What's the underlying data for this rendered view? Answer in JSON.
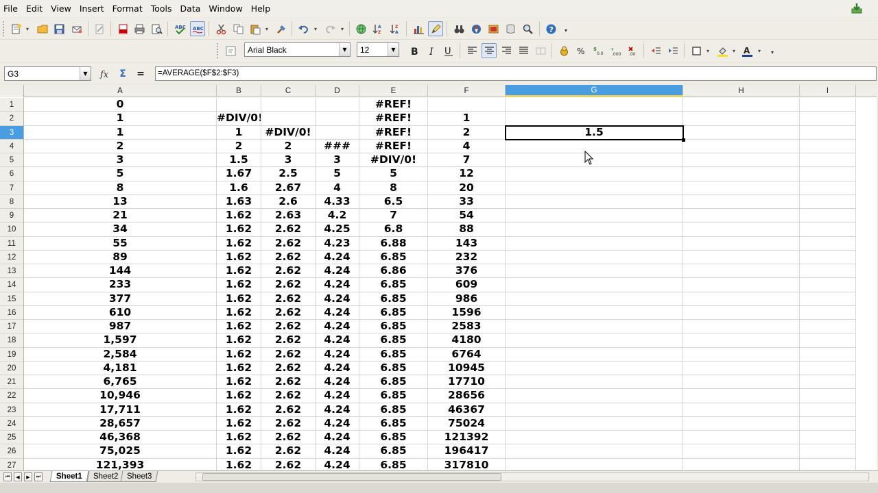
{
  "menu": [
    "File",
    "Edit",
    "View",
    "Insert",
    "Format",
    "Tools",
    "Data",
    "Window",
    "Help"
  ],
  "formatting": {
    "font_name": "Arial Black",
    "font_size": "12"
  },
  "formula_bar": {
    "name_box": "G3",
    "formula": "=AVERAGE($F$2:$F3)",
    "fx_label": "ƒx",
    "sum_label": "Σ",
    "equals_label": "="
  },
  "columns": [
    "A",
    "B",
    "C",
    "D",
    "E",
    "F",
    "G",
    "H",
    "I"
  ],
  "selected_column": "G",
  "selected_row": "3",
  "rows": [
    {
      "n": "1",
      "cells": [
        "0",
        "",
        "",
        "",
        "#REF!",
        "",
        "",
        "",
        ""
      ]
    },
    {
      "n": "2",
      "cells": [
        "1",
        "#DIV/0!",
        "",
        "",
        "#REF!",
        "1",
        "",
        "",
        ""
      ]
    },
    {
      "n": "3",
      "cells": [
        "1",
        "1",
        "#DIV/0!",
        "",
        "#REF!",
        "2",
        "1.5",
        "",
        ""
      ]
    },
    {
      "n": "4",
      "cells": [
        "2",
        "2",
        "2",
        "###",
        "#REF!",
        "4",
        "",
        "",
        ""
      ]
    },
    {
      "n": "5",
      "cells": [
        "3",
        "1.5",
        "3",
        "3",
        "#DIV/0!",
        "7",
        "",
        "",
        ""
      ]
    },
    {
      "n": "6",
      "cells": [
        "5",
        "1.67",
        "2.5",
        "5",
        "5",
        "12",
        "",
        "",
        ""
      ]
    },
    {
      "n": "7",
      "cells": [
        "8",
        "1.6",
        "2.67",
        "4",
        "8",
        "20",
        "",
        "",
        ""
      ]
    },
    {
      "n": "8",
      "cells": [
        "13",
        "1.63",
        "2.6",
        "4.33",
        "6.5",
        "33",
        "",
        "",
        ""
      ]
    },
    {
      "n": "9",
      "cells": [
        "21",
        "1.62",
        "2.63",
        "4.2",
        "7",
        "54",
        "",
        "",
        ""
      ]
    },
    {
      "n": "10",
      "cells": [
        "34",
        "1.62",
        "2.62",
        "4.25",
        "6.8",
        "88",
        "",
        "",
        ""
      ]
    },
    {
      "n": "11",
      "cells": [
        "55",
        "1.62",
        "2.62",
        "4.23",
        "6.88",
        "143",
        "",
        "",
        ""
      ]
    },
    {
      "n": "12",
      "cells": [
        "89",
        "1.62",
        "2.62",
        "4.24",
        "6.85",
        "232",
        "",
        "",
        ""
      ]
    },
    {
      "n": "13",
      "cells": [
        "144",
        "1.62",
        "2.62",
        "4.24",
        "6.86",
        "376",
        "",
        "",
        ""
      ]
    },
    {
      "n": "14",
      "cells": [
        "233",
        "1.62",
        "2.62",
        "4.24",
        "6.85",
        "609",
        "",
        "",
        ""
      ]
    },
    {
      "n": "15",
      "cells": [
        "377",
        "1.62",
        "2.62",
        "4.24",
        "6.85",
        "986",
        "",
        "",
        ""
      ]
    },
    {
      "n": "16",
      "cells": [
        "610",
        "1.62",
        "2.62",
        "4.24",
        "6.85",
        "1596",
        "",
        "",
        ""
      ]
    },
    {
      "n": "17",
      "cells": [
        "987",
        "1.62",
        "2.62",
        "4.24",
        "6.85",
        "2583",
        "",
        "",
        ""
      ]
    },
    {
      "n": "18",
      "cells": [
        "1,597",
        "1.62",
        "2.62",
        "4.24",
        "6.85",
        "4180",
        "",
        "",
        ""
      ]
    },
    {
      "n": "19",
      "cells": [
        "2,584",
        "1.62",
        "2.62",
        "4.24",
        "6.85",
        "6764",
        "",
        "",
        ""
      ]
    },
    {
      "n": "20",
      "cells": [
        "4,181",
        "1.62",
        "2.62",
        "4.24",
        "6.85",
        "10945",
        "",
        "",
        ""
      ]
    },
    {
      "n": "21",
      "cells": [
        "6,765",
        "1.62",
        "2.62",
        "4.24",
        "6.85",
        "17710",
        "",
        "",
        ""
      ]
    },
    {
      "n": "22",
      "cells": [
        "10,946",
        "1.62",
        "2.62",
        "4.24",
        "6.85",
        "28656",
        "",
        "",
        ""
      ]
    },
    {
      "n": "23",
      "cells": [
        "17,711",
        "1.62",
        "2.62",
        "4.24",
        "6.85",
        "46367",
        "",
        "",
        ""
      ]
    },
    {
      "n": "24",
      "cells": [
        "28,657",
        "1.62",
        "2.62",
        "4.24",
        "6.85",
        "75024",
        "",
        "",
        ""
      ]
    },
    {
      "n": "25",
      "cells": [
        "46,368",
        "1.62",
        "2.62",
        "4.24",
        "6.85",
        "121392",
        "",
        "",
        ""
      ]
    },
    {
      "n": "26",
      "cells": [
        "75,025",
        "1.62",
        "2.62",
        "4.24",
        "6.85",
        "196417",
        "",
        "",
        ""
      ]
    },
    {
      "n": "27",
      "cells": [
        "121,393",
        "1.62",
        "2.62",
        "4.24",
        "6.85",
        "317810",
        "",
        "",
        ""
      ]
    }
  ],
  "sheets": [
    "Sheet1",
    "Sheet2",
    "Sheet3"
  ],
  "active_sheet": "Sheet1",
  "colors": {
    "selection_header": "#4a9de0",
    "header_underline": "#f1d25c"
  }
}
